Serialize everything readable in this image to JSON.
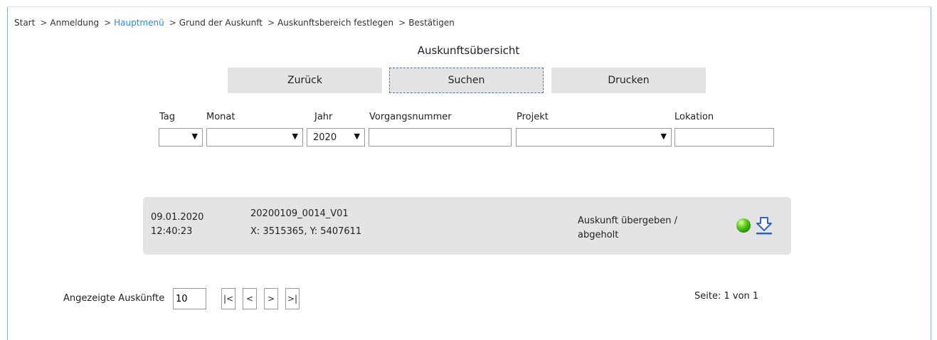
{
  "breadcrumb": {
    "items": [
      "Start",
      "Anmeldung",
      "Hauptmenü",
      "Grund der Auskunft",
      "Auskunftsbereich festlegen",
      "Bestätigen"
    ],
    "separator": ">",
    "active_color": "#2b8ad6"
  },
  "title": "Auskunftsübersicht",
  "buttons": {
    "back": "Zurück",
    "search": "Suchen",
    "print": "Drucken"
  },
  "filters": {
    "day": {
      "label": "Tag",
      "value": ""
    },
    "month": {
      "label": "Monat",
      "value": ""
    },
    "year": {
      "label": "Jahr",
      "value": "2020"
    },
    "case_number": {
      "label": "Vorgangsnummer",
      "value": ""
    },
    "project": {
      "label": "Projekt",
      "value": ""
    },
    "location": {
      "label": "Lokation",
      "value": ""
    },
    "dropdown_glyph": "▼"
  },
  "results": [
    {
      "date": "09.01.2020",
      "time": "12:40:23",
      "id": "20200109_0014_V01",
      "coords": "X: 3515365, Y: 5407611",
      "status_line1": "Auskunft übergeben /",
      "status_line2": "abgeholt",
      "status_icon": "green-status-dot",
      "action_icon": "download-icon"
    }
  ],
  "pagination": {
    "count_label": "Angezeigte Auskünfte",
    "count_value": "10",
    "first": "|<",
    "prev": "<",
    "next": ">",
    "last": ">|",
    "page_info": "Seite: 1 von 1"
  }
}
